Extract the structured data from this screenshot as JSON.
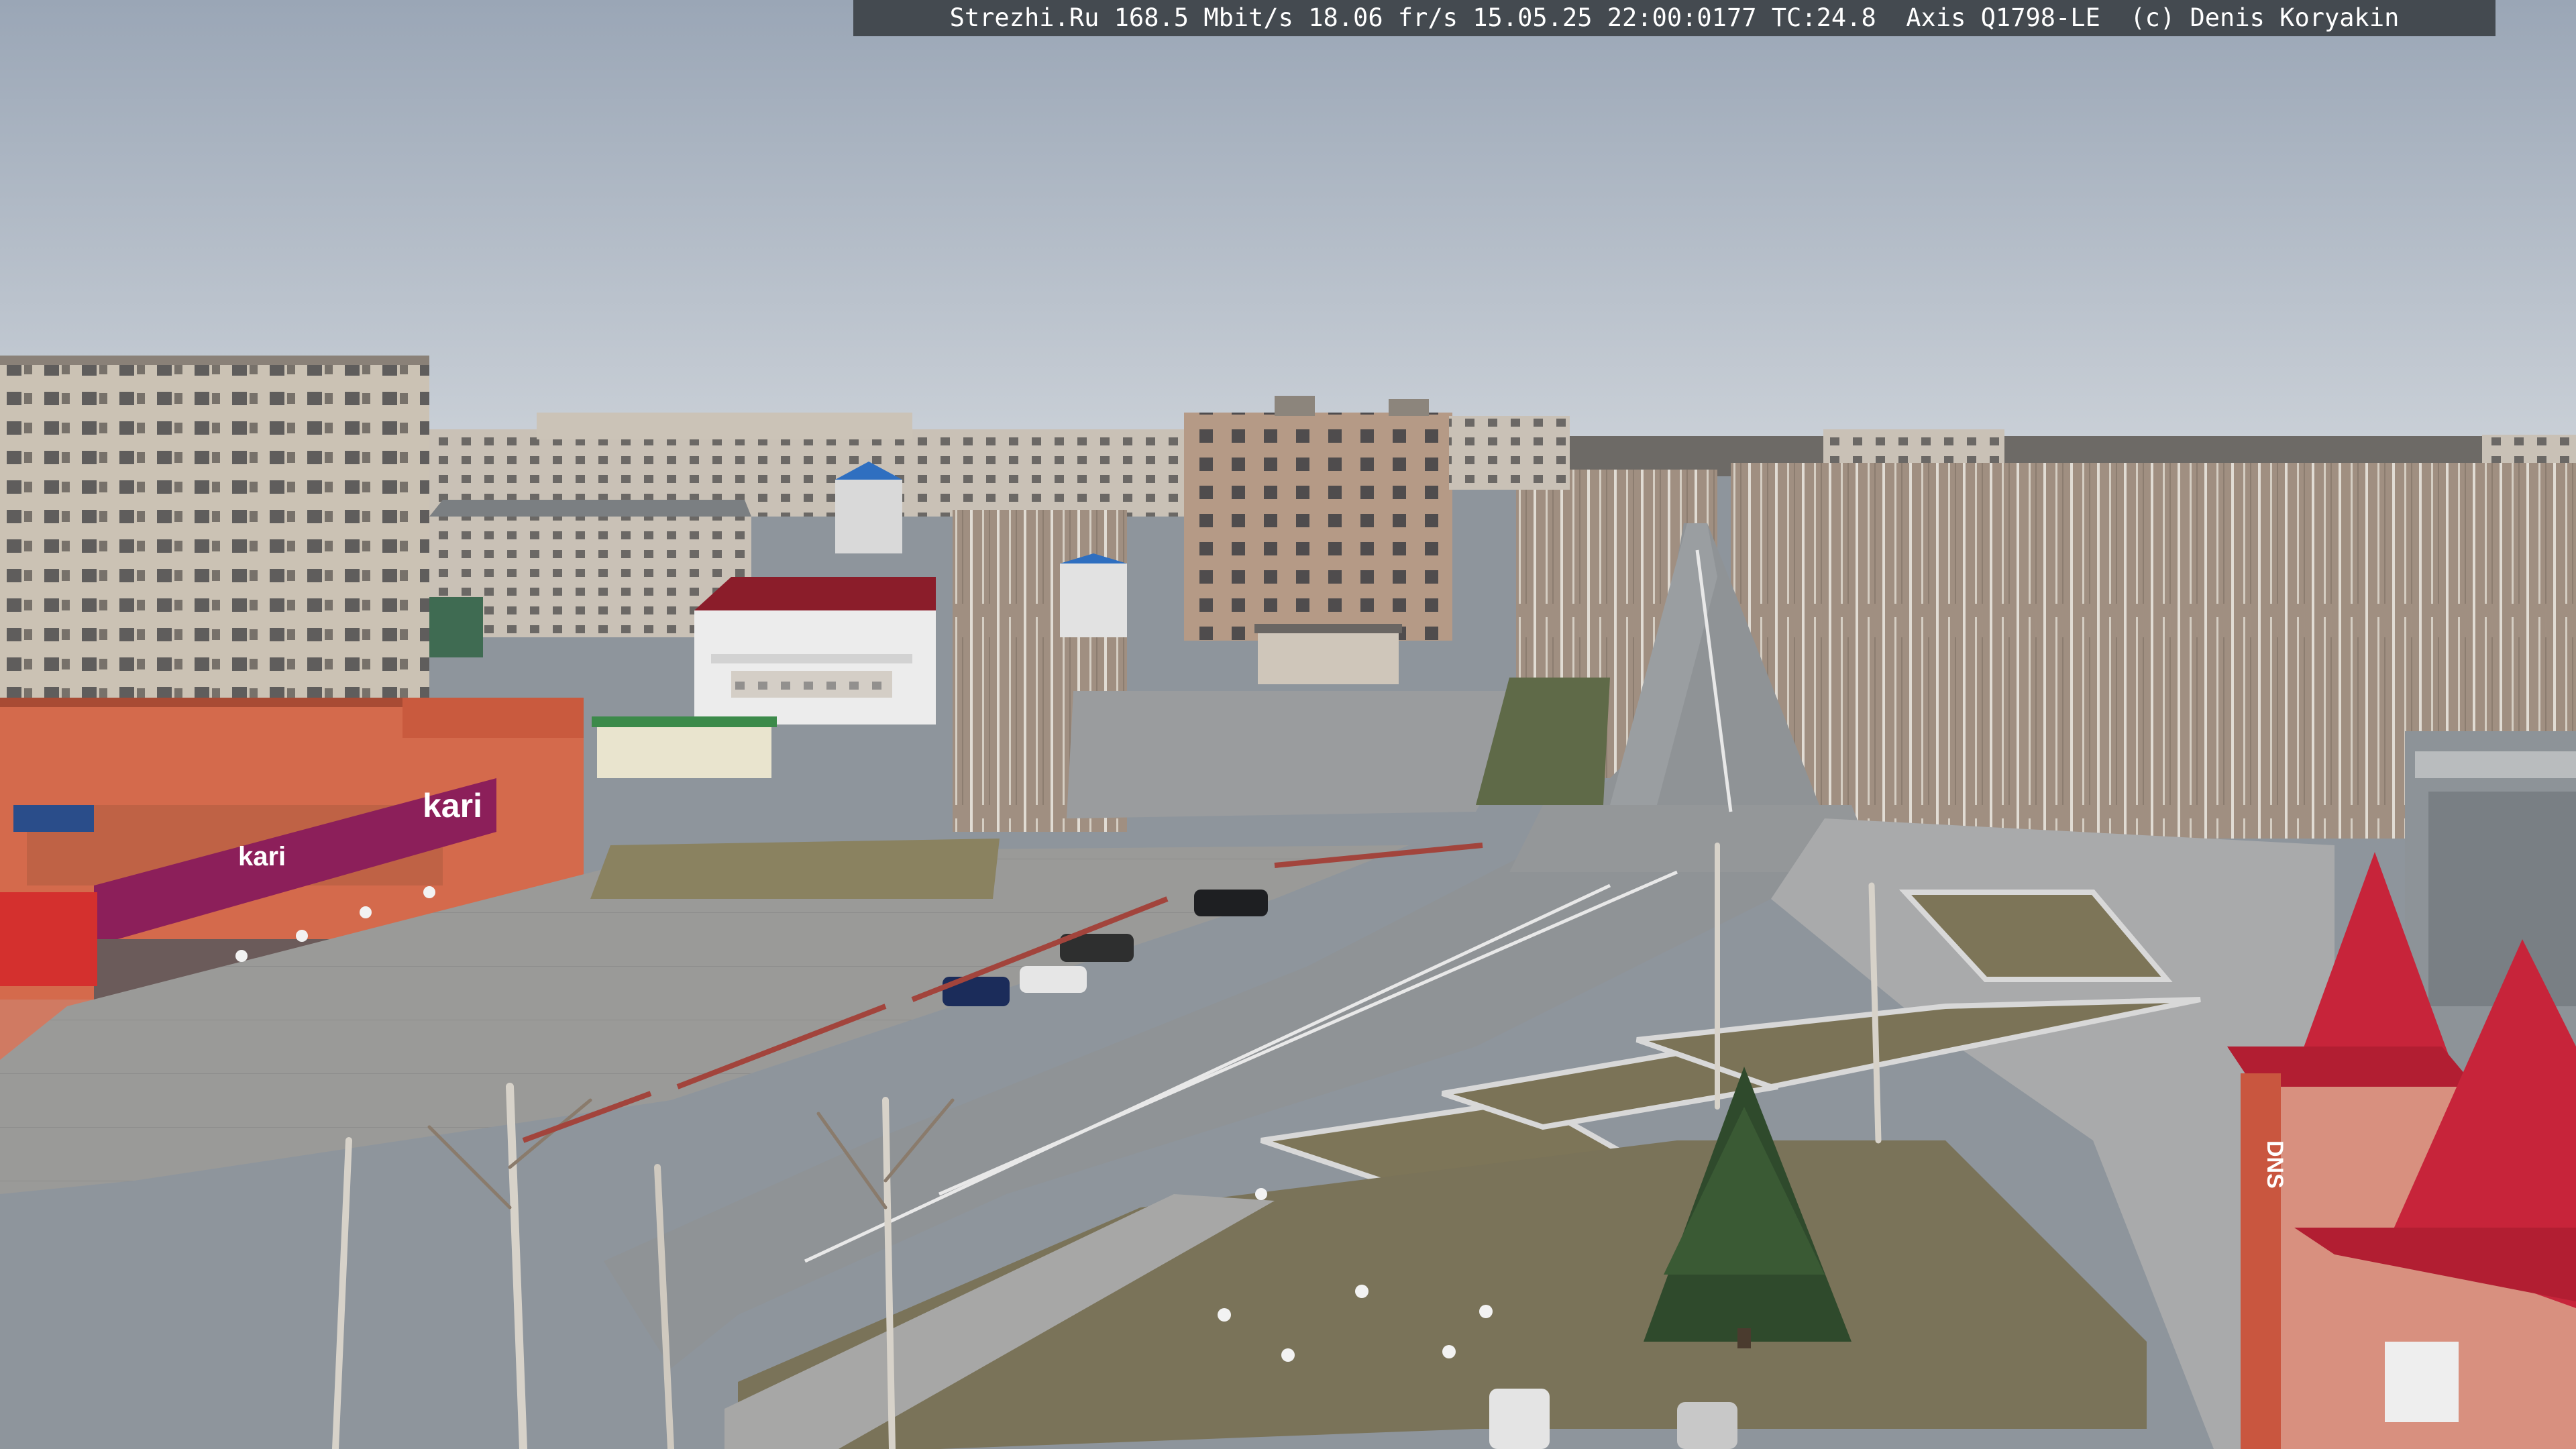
{
  "camera_overlay": {
    "text": "Strezhi.Ru 168.5 Mbit/s 18.06 fr/s 15.05.25 22:00:0177 TC:24.8  Axis Q1798-LE  (c) Denis Koryakin"
  },
  "signs": {
    "kari_main": "kari",
    "kari_small": "kari",
    "dns": "DNS"
  },
  "colors": {
    "sky_top": "#9aa6b6",
    "sky_bottom": "#c9cfd6",
    "road": "#8f9396",
    "grass": "#7d7558",
    "panel_block": "#c8bfb1",
    "brick_block": "#b9a08c",
    "orange_mall": "#d46a4c",
    "kari_purple": "#8c1f5a",
    "red_roof": "#c7243a",
    "pink_tower": "#d8907f",
    "tree_trunk": "#d7d2c9",
    "tree_branch": "#8a7b6c",
    "pine": "#2f4a2c"
  }
}
